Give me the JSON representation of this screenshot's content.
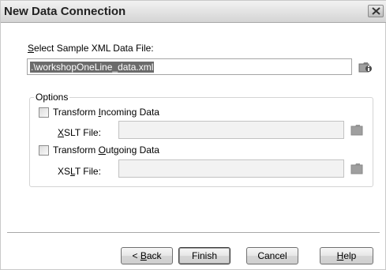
{
  "window": {
    "title": "New Data Connection"
  },
  "sample_file": {
    "label_prefix": "S",
    "label_rest": "elect Sample XML Data File:",
    "value": ".\\workshopOneLine_data.xml"
  },
  "options": {
    "legend": "Options",
    "incoming": {
      "checkbox_label_pre": "Transform ",
      "checkbox_label_key": "I",
      "checkbox_label_post": "ncoming Data",
      "checked": false,
      "xslt_label_key": "X",
      "xslt_label_post": "SLT File:",
      "xslt_value": ""
    },
    "outgoing": {
      "checkbox_label_pre": "Transform ",
      "checkbox_label_key": "O",
      "checkbox_label_post": "utgoing Data",
      "checked": false,
      "xslt_label_pre": "XS",
      "xslt_label_key": "L",
      "xslt_label_post": "T File:",
      "xslt_value": ""
    }
  },
  "buttons": {
    "back_pre": "< ",
    "back_key": "B",
    "back_post": "ack",
    "finish": "Finish",
    "cancel": "Cancel",
    "help_key": "H",
    "help_post": "elp"
  },
  "icons": {
    "close": "close-icon",
    "browse": "folder-open-icon",
    "folder": "folder-icon"
  }
}
